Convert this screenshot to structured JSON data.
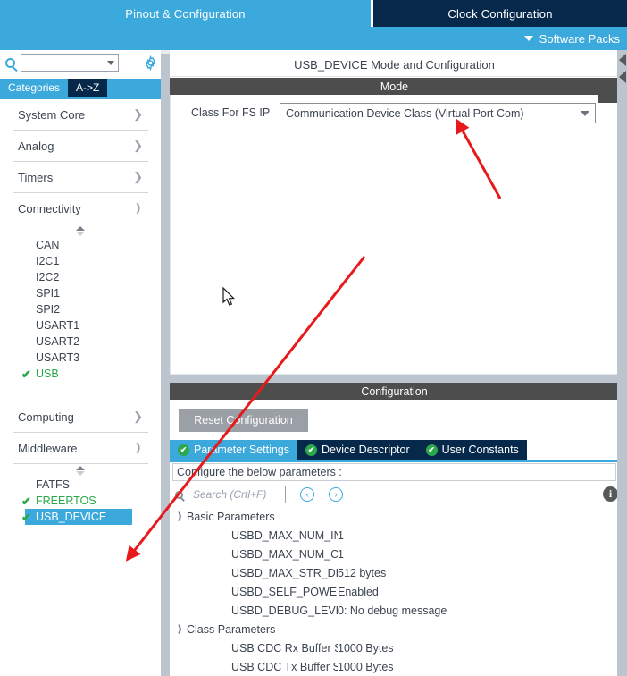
{
  "header": {
    "tabs": [
      {
        "label": "Pinout & Configuration",
        "active": true
      },
      {
        "label": "Clock Configuration",
        "active": false
      }
    ],
    "software_packs": "Software Packs"
  },
  "left_panel": {
    "search_placeholder": "",
    "search_value": "",
    "gear_icon": "gear-icon",
    "view_tabs": [
      {
        "label": "Categories",
        "active": true
      },
      {
        "label": "A->Z",
        "active": false
      }
    ],
    "groups": [
      {
        "label": "System Core",
        "expanded": false
      },
      {
        "label": "Analog",
        "expanded": false
      },
      {
        "label": "Timers",
        "expanded": false
      },
      {
        "label": "Connectivity",
        "expanded": true
      },
      {
        "label": "Computing",
        "expanded": false
      },
      {
        "label": "Middleware",
        "expanded": true
      }
    ],
    "connectivity_items": [
      {
        "label": "CAN",
        "checked": false,
        "selected": false
      },
      {
        "label": "I2C1",
        "checked": false,
        "selected": false
      },
      {
        "label": "I2C2",
        "checked": false,
        "selected": false
      },
      {
        "label": "SPI1",
        "checked": false,
        "selected": false
      },
      {
        "label": "SPI2",
        "checked": false,
        "selected": false
      },
      {
        "label": "USART1",
        "checked": false,
        "selected": false
      },
      {
        "label": "USART2",
        "checked": false,
        "selected": false
      },
      {
        "label": "USART3",
        "checked": false,
        "selected": false
      },
      {
        "label": "USB",
        "checked": true,
        "selected": false
      }
    ],
    "middleware_items": [
      {
        "label": "FATFS",
        "checked": false,
        "selected": false
      },
      {
        "label": "FREERTOS",
        "checked": true,
        "selected": false
      },
      {
        "label": "USB_DEVICE",
        "checked": true,
        "selected": true
      }
    ]
  },
  "main": {
    "title": "USB_DEVICE Mode and Configuration",
    "mode": {
      "section_label": "Mode",
      "class_label": "Class For FS IP",
      "class_value": "Communication Device Class (Virtual Port Com)"
    },
    "configuration": {
      "section_label": "Configuration",
      "reset_button": "Reset Configuration",
      "tabs": [
        {
          "label": "Parameter Settings",
          "active": true
        },
        {
          "label": "Device Descriptor",
          "active": false
        },
        {
          "label": "User Constants",
          "active": false
        }
      ],
      "note": "Configure the below parameters :",
      "search_placeholder": "Search (Crtl+F)",
      "search_value": "",
      "nav_prev": "‹",
      "nav_next": "›",
      "info_icon": "info-icon",
      "param_groups": [
        {
          "label": "Basic Parameters",
          "expanded": true,
          "rows": [
            {
              "name": "USBD_MAX_NUM_INTERFA...",
              "value": "1"
            },
            {
              "name": "USBD_MAX_NUM_CONFIGU...",
              "value": "1"
            },
            {
              "name": "USBD_MAX_STR_DESC_SIZ...",
              "value": "512 bytes"
            },
            {
              "name": "USBD_SELF_POWERED (E...",
              "value": "Enabled"
            },
            {
              "name": "USBD_DEBUG_LEVEL (US...",
              "value": "0: No debug message"
            }
          ]
        },
        {
          "label": "Class Parameters",
          "expanded": true,
          "rows": [
            {
              "name": "USB CDC Rx Buffer Size",
              "value": "1000 Bytes"
            },
            {
              "name": "USB CDC Tx Buffer Size",
              "value": "1000 Bytes"
            }
          ]
        }
      ]
    }
  },
  "colors": {
    "accent_light_blue": "#3ba9dc",
    "accent_dark_navy": "#06284b",
    "section_header_gray": "#4d4d4d",
    "check_green": "#2aa84a",
    "annotation_red": "#e8191b",
    "splitter_gray": "#bcc5ce"
  }
}
